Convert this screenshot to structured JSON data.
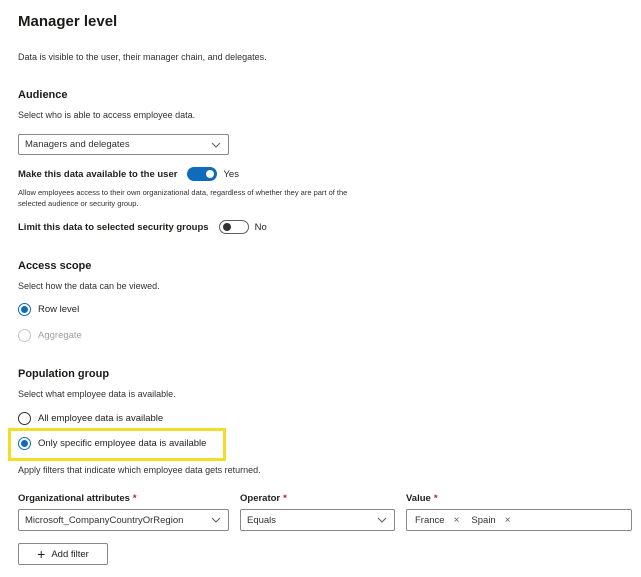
{
  "page": {
    "title": "Manager level",
    "description": "Data is visible to the user, their manager chain, and delegates."
  },
  "audience": {
    "heading": "Audience",
    "description": "Select who is able to access employee data.",
    "dropdown_value": "Managers and delegates",
    "make_available": {
      "label": "Make this data available to the user",
      "state": "Yes",
      "on": true,
      "help": "Allow employees access to their own organizational data, regardless of whether they are part of the selected audience or security group.",
      "help_line1": "Allow employees access to their own organizational data, regardless of whether they are part of the",
      "help_line2": "selected audience or security group."
    },
    "limit_groups": {
      "label": "Limit this data to selected security groups",
      "state": "No",
      "on": false
    }
  },
  "access_scope": {
    "heading": "Access scope",
    "description": "Select how the data can be viewed.",
    "options": [
      {
        "label": "Row level",
        "selected": true,
        "disabled": false
      },
      {
        "label": "Aggregate",
        "selected": false,
        "disabled": true
      }
    ]
  },
  "population_group": {
    "heading": "Population group",
    "description": "Select what employee data is available.",
    "options": [
      {
        "label": "All employee data is available",
        "selected": false
      },
      {
        "label": "Only specific employee data is available",
        "selected": true
      }
    ],
    "filter_hint": "Apply filters that indicate which employee data gets returned."
  },
  "filters": {
    "org_attr_label": "Organizational attributes",
    "operator_label": "Operator",
    "value_label": "Value",
    "required_mark": "*",
    "org_attr_value": "Microsoft_CompanyCountryOrRegion",
    "operator_value": "Equals",
    "values": [
      "France",
      "Spain"
    ],
    "chip_remove_glyph": "×",
    "add_filter_label": "Add filter",
    "add_filter_glyph": "+"
  },
  "colors": {
    "accent": "#0f6cbd",
    "highlight": "#f2dd29",
    "required": "#a4262c"
  }
}
